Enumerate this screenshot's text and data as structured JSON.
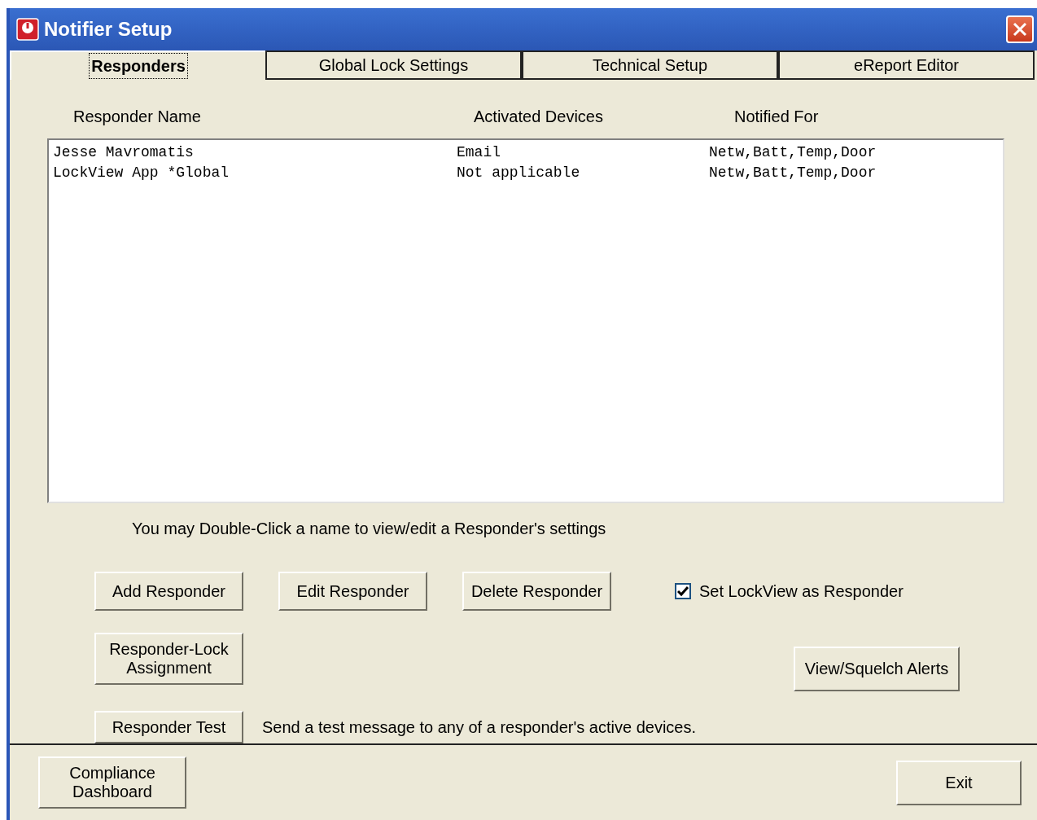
{
  "window": {
    "title": "Notifier Setup"
  },
  "tabs": [
    {
      "label": "Responders",
      "selected": true
    },
    {
      "label": "Global Lock Settings",
      "selected": false
    },
    {
      "label": "Technical Setup",
      "selected": false
    },
    {
      "label": "eReport Editor",
      "selected": false
    }
  ],
  "list": {
    "columns": [
      "Responder Name",
      "Activated Devices",
      "Notified For"
    ],
    "rows": [
      [
        "Jesse Mavromatis",
        "Email",
        "Netw,Batt,Temp,Door"
      ],
      [
        "LockView App *Global",
        "Not applicable",
        "Netw,Batt,Temp,Door"
      ]
    ]
  },
  "hint": "You may Double-Click a name to view/edit a Responder's settings",
  "buttons": [
    "Add Responder",
    "Edit Responder",
    "Delete Responder"
  ],
  "lockview_checkbox": {
    "label": "Set LockView as Responder",
    "checked": true
  },
  "assignment_button": "Responder-Lock Assignment",
  "squelch_button": "View/Squelch Alerts",
  "test_button": "Responder Test",
  "test_note": "Send a test message to any of a responder's active devices.",
  "footer_buttons": [
    "Compliance Dashboard",
    "Exit"
  ]
}
